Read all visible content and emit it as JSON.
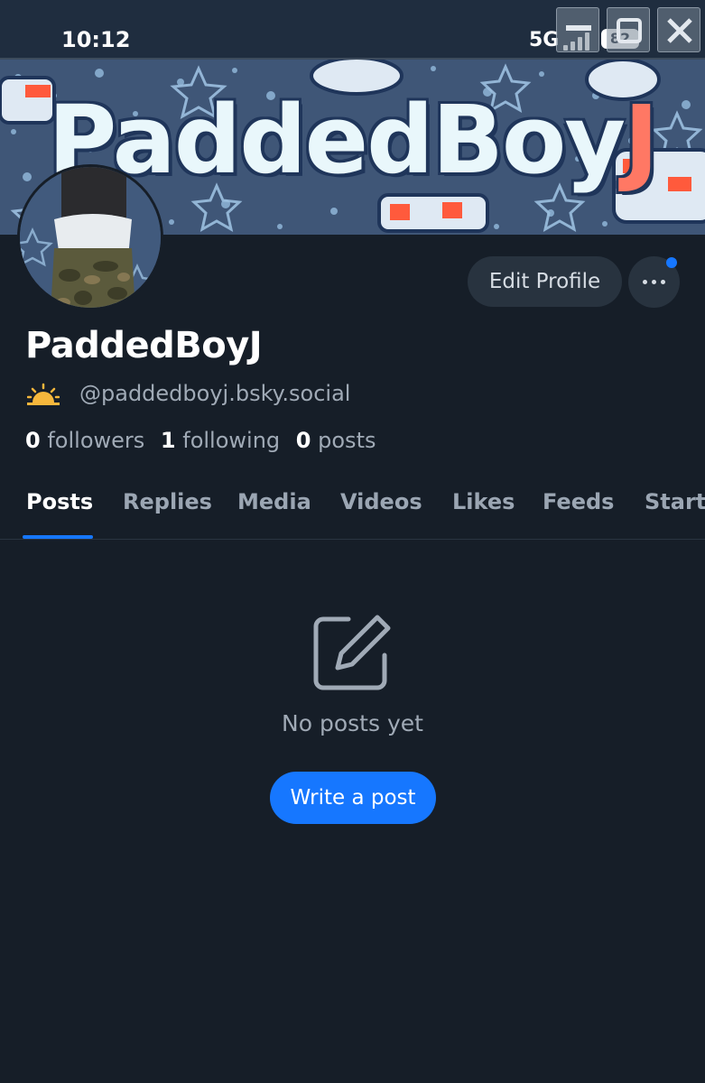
{
  "status_bar": {
    "time": "10:12",
    "network": "5G",
    "battery": "82",
    "icons": [
      "signal-icon",
      "minimize-icon",
      "restore-icon",
      "close-icon"
    ]
  },
  "banner": {
    "title_main": "PaddedBoy",
    "title_accent": "J",
    "colors": {
      "background": "#3f5677",
      "title": "#e9f7fb",
      "accent": "#ff7864"
    }
  },
  "profile": {
    "display_name": "PaddedBoyJ",
    "handle": "@paddedboyj.bsky.social",
    "handle_icon": "sun-icon",
    "edit_label": "Edit Profile",
    "more_icon": "ellipsis-icon",
    "stats": {
      "followers_count": "0",
      "followers_label": "followers",
      "following_count": "1",
      "following_label": "following",
      "posts_count": "0",
      "posts_label": "posts"
    }
  },
  "tabs": [
    {
      "label": "Posts",
      "active": true
    },
    {
      "label": "Replies",
      "active": false
    },
    {
      "label": "Media",
      "active": false
    },
    {
      "label": "Videos",
      "active": false
    },
    {
      "label": "Likes",
      "active": false
    },
    {
      "label": "Feeds",
      "active": false
    },
    {
      "label": "Starte",
      "active": false
    }
  ],
  "empty_state": {
    "icon": "edit-icon",
    "text": "No posts yet",
    "button_label": "Write a post"
  },
  "colors": {
    "background": "#161e28",
    "accent": "#1677ff",
    "muted_text": "#a0aab6"
  }
}
